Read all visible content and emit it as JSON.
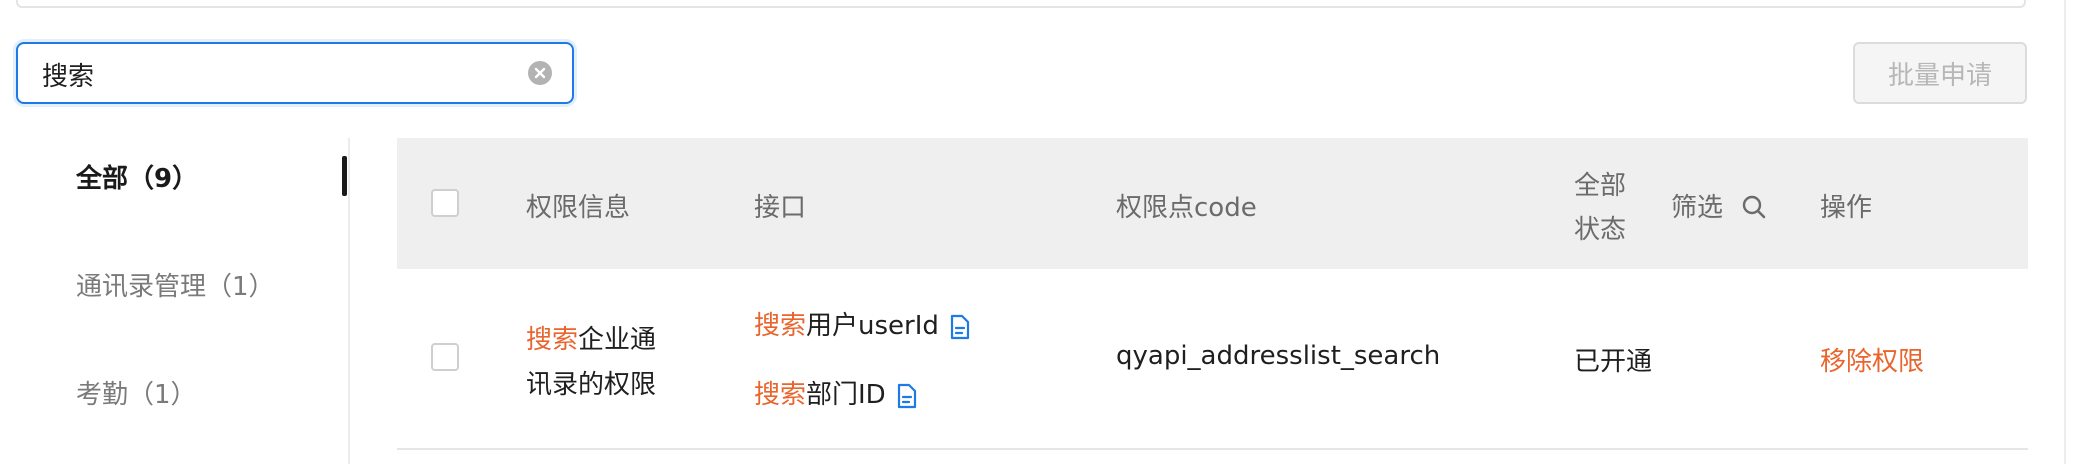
{
  "search": {
    "value": "搜索"
  },
  "toolbar": {
    "batch_apply_label": "批量申请"
  },
  "categories": [
    {
      "label": "全部（9）",
      "active": true
    },
    {
      "label": "通讯录管理（1）",
      "active": false
    },
    {
      "label": "考勤（1）",
      "active": false
    }
  ],
  "table": {
    "headers": {
      "permission_info": "权限信息",
      "interface": "接口",
      "permission_code": "权限点code",
      "status_line1": "全部",
      "status_line2": "状态",
      "filter": "筛选",
      "action": "操作"
    },
    "rows": [
      {
        "permission_hl": "搜索",
        "permission_rest1": "企业通",
        "permission_line2": "讯录的权限",
        "interfaces": [
          {
            "hl": "搜索",
            "rest": "用户userId"
          },
          {
            "hl": "搜索",
            "rest": "部门ID"
          }
        ],
        "code": "qyapi_addresslist_search",
        "status": "已开通",
        "action": "移除权限"
      }
    ]
  },
  "colors": {
    "accent": "#e9652d",
    "focus": "#1e7ae6",
    "header_bg": "#efefef"
  }
}
